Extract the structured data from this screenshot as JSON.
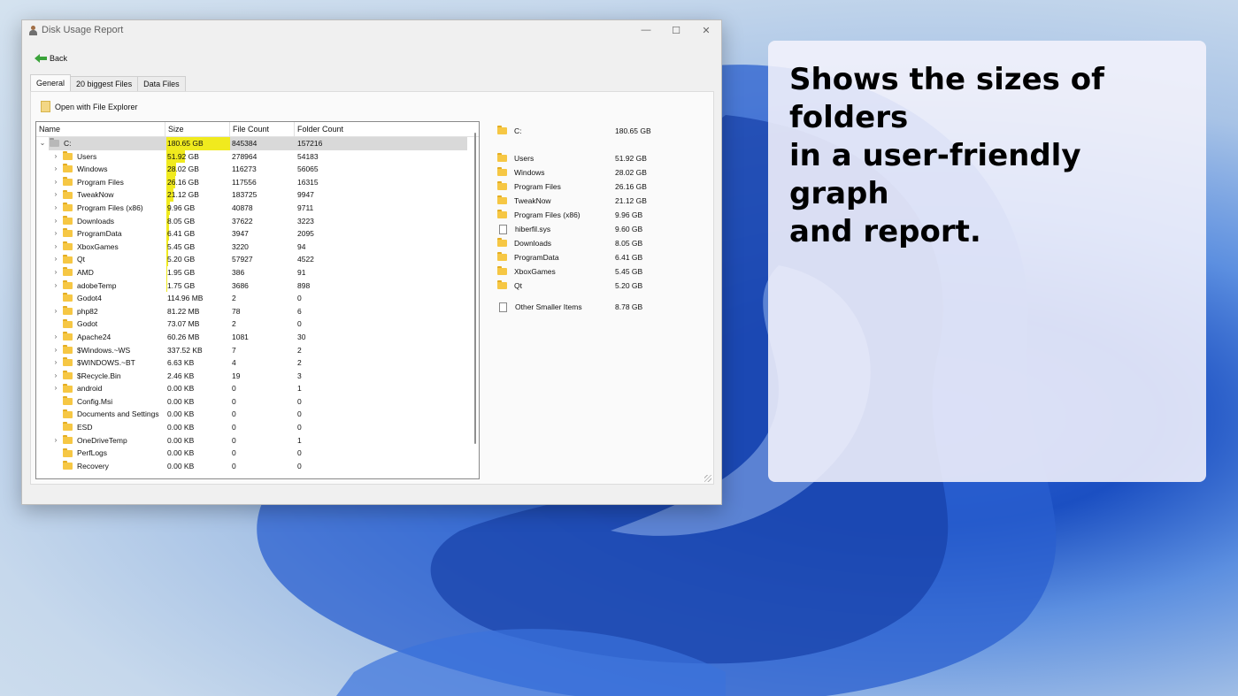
{
  "window": {
    "title": "Disk Usage Report",
    "minimize_glyph": "—",
    "maximize_glyph": "☐",
    "close_glyph": "✕"
  },
  "toolbar": {
    "back_label": "Back"
  },
  "tabs": [
    {
      "label": "General",
      "active": true
    },
    {
      "label": "20 biggest Files",
      "active": false
    },
    {
      "label": "Data Files",
      "active": false
    }
  ],
  "actions": {
    "open_explorer_label": "Open with File Explorer"
  },
  "tree": {
    "columns": [
      "Name",
      "Size",
      "File Count",
      "Folder Count"
    ],
    "rows": [
      {
        "name": "C:",
        "size": "180.65 GB",
        "files": "845384",
        "folders": "157216",
        "expander": "expanded",
        "fill": 1.0
      },
      {
        "name": "Users",
        "size": "51.92 GB",
        "files": "278964",
        "folders": "54183",
        "expander": "collapsed",
        "fill": 0.2874
      },
      {
        "name": "Windows",
        "size": "28.02 GB",
        "files": "116273",
        "folders": "56065",
        "expander": "collapsed",
        "fill": 0.1551
      },
      {
        "name": "Program Files",
        "size": "26.16 GB",
        "files": "117556",
        "folders": "16315",
        "expander": "collapsed",
        "fill": 0.1448
      },
      {
        "name": "TweakNow",
        "size": "21.12 GB",
        "files": "183725",
        "folders": "9947",
        "expander": "collapsed",
        "fill": 0.1169
      },
      {
        "name": "Program Files (x86)",
        "size": "9.96 GB",
        "files": "40878",
        "folders": "9711",
        "expander": "collapsed",
        "fill": 0.0551
      },
      {
        "name": "Downloads",
        "size": "8.05 GB",
        "files": "37622",
        "folders": "3223",
        "expander": "collapsed",
        "fill": 0.0446
      },
      {
        "name": "ProgramData",
        "size": "6.41 GB",
        "files": "3947",
        "folders": "2095",
        "expander": "collapsed",
        "fill": 0.0355
      },
      {
        "name": "XboxGames",
        "size": "5.45 GB",
        "files": "3220",
        "folders": "94",
        "expander": "collapsed",
        "fill": 0.0302
      },
      {
        "name": "Qt",
        "size": "5.20 GB",
        "files": "57927",
        "folders": "4522",
        "expander": "collapsed",
        "fill": 0.0288
      },
      {
        "name": "AMD",
        "size": "1.95 GB",
        "files": "386",
        "folders": "91",
        "expander": "collapsed",
        "fill": 0.0108
      },
      {
        "name": "adobeTemp",
        "size": "1.75 GB",
        "files": "3686",
        "folders": "898",
        "expander": "collapsed",
        "fill": 0.0097
      },
      {
        "name": "Godot4",
        "size": "114.96 MB",
        "files": "2",
        "folders": "0",
        "expander": "none",
        "fill": 0.0006
      },
      {
        "name": "php82",
        "size": "81.22 MB",
        "files": "78",
        "folders": "6",
        "expander": "collapsed",
        "fill": 0.0004
      },
      {
        "name": "Godot",
        "size": "73.07 MB",
        "files": "2",
        "folders": "0",
        "expander": "none",
        "fill": 0.0004
      },
      {
        "name": "Apache24",
        "size": "60.26 MB",
        "files": "1081",
        "folders": "30",
        "expander": "collapsed",
        "fill": 0.0003
      },
      {
        "name": "$Windows.~WS",
        "size": "337.52 KB",
        "files": "7",
        "folders": "2",
        "expander": "collapsed",
        "fill": 0
      },
      {
        "name": "$WINDOWS.~BT",
        "size": "6.63 KB",
        "files": "4",
        "folders": "2",
        "expander": "collapsed",
        "fill": 0
      },
      {
        "name": "$Recycle.Bin",
        "size": "2.46 KB",
        "files": "19",
        "folders": "3",
        "expander": "collapsed",
        "fill": 0
      },
      {
        "name": "android",
        "size": "0.00 KB",
        "files": "0",
        "folders": "1",
        "expander": "collapsed",
        "fill": 0
      },
      {
        "name": "Config.Msi",
        "size": "0.00 KB",
        "files": "0",
        "folders": "0",
        "expander": "none",
        "fill": 0
      },
      {
        "name": "Documents and Settings",
        "size": "0.00 KB",
        "files": "0",
        "folders": "0",
        "expander": "none",
        "fill": 0
      },
      {
        "name": "ESD",
        "size": "0.00 KB",
        "files": "0",
        "folders": "0",
        "expander": "none",
        "fill": 0
      },
      {
        "name": "OneDriveTemp",
        "size": "0.00 KB",
        "files": "0",
        "folders": "1",
        "expander": "collapsed",
        "fill": 0
      },
      {
        "name": "PerfLogs",
        "size": "0.00 KB",
        "files": "0",
        "folders": "0",
        "expander": "none",
        "fill": 0
      },
      {
        "name": "Recovery",
        "size": "0.00 KB",
        "files": "0",
        "folders": "0",
        "expander": "none",
        "fill": 0
      }
    ]
  },
  "summary": {
    "total": {
      "name": "C:",
      "size": "180.65 GB"
    },
    "items": [
      {
        "name": "Users",
        "size": "51.92 GB",
        "icon": "folder-icon"
      },
      {
        "name": "Windows",
        "size": "28.02 GB",
        "icon": "folder-icon"
      },
      {
        "name": "Program Files",
        "size": "26.16 GB",
        "icon": "folder-icon"
      },
      {
        "name": "TweakNow",
        "size": "21.12 GB",
        "icon": "folder-icon"
      },
      {
        "name": "Program Files (x86)",
        "size": "9.96 GB",
        "icon": "folder-icon"
      },
      {
        "name": "hiberfil.sys",
        "size": "9.60 GB",
        "icon": "file-icon"
      },
      {
        "name": "Downloads",
        "size": "8.05 GB",
        "icon": "folder-icon"
      },
      {
        "name": "ProgramData",
        "size": "6.41 GB",
        "icon": "folder-icon"
      },
      {
        "name": "XboxGames",
        "size": "5.45 GB",
        "icon": "folder-icon"
      },
      {
        "name": "Qt",
        "size": "5.20 GB",
        "icon": "folder-icon"
      }
    ],
    "other": {
      "name": "Other Smaller Items",
      "size": "8.78 GB",
      "icon": "document-icon"
    }
  },
  "callout": {
    "lines": [
      "Shows the sizes of folders",
      "in a user-friendly graph",
      "and report."
    ]
  },
  "colors": {
    "size_bar": "#f0ea1e",
    "selection": "#d9d9d9",
    "folder": "#f6c744"
  }
}
